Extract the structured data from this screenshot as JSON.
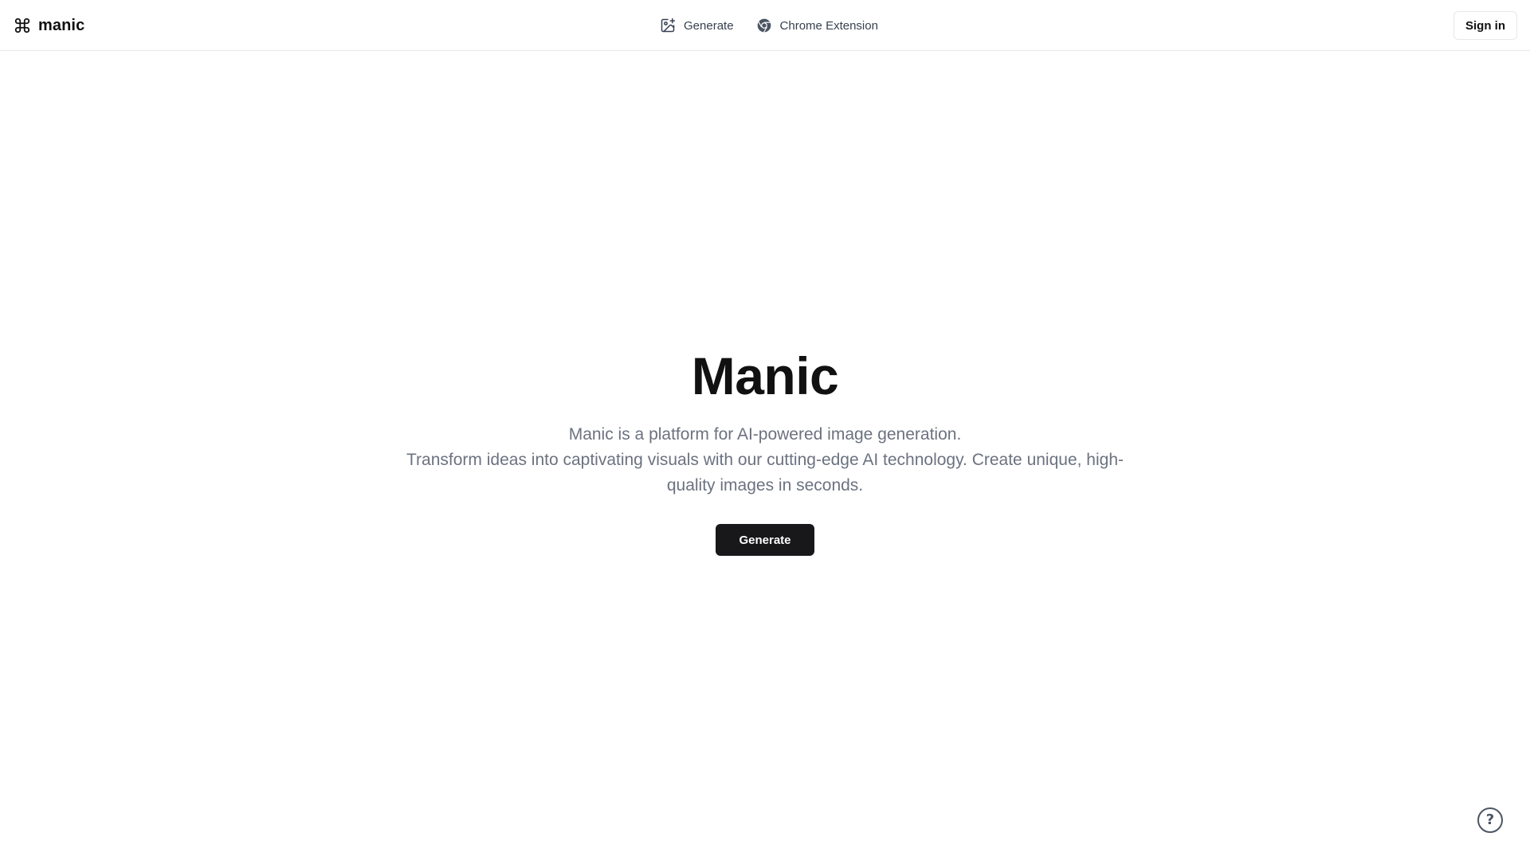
{
  "header": {
    "brand": {
      "name": "manic",
      "icon": "command-icon"
    },
    "nav": [
      {
        "label": "Generate",
        "icon": "image-plus-icon"
      },
      {
        "label": "Chrome Extension",
        "icon": "chrome-icon"
      }
    ],
    "signin_label": "Sign in"
  },
  "hero": {
    "title": "Manic",
    "description_lines": [
      "Manic is a platform for AI-powered image generation.",
      "Transform ideas into captivating visuals with our cutting-edge AI technology. Create unique, high-quality images in seconds."
    ],
    "cta_label": "Generate"
  },
  "help": {
    "icon": "help-circle-icon",
    "glyph": "?"
  },
  "colors": {
    "primary_button_bg": "#18181b",
    "primary_button_text": "#ffffff",
    "muted_text": "#6b7280",
    "border": "#e5e7eb"
  }
}
